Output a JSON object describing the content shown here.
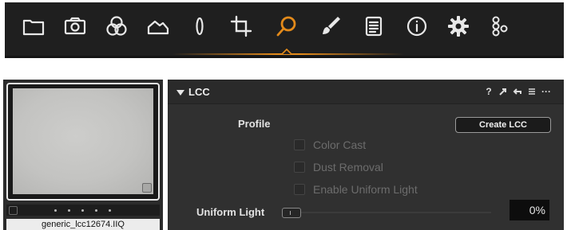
{
  "toolbar": {
    "active_tool": "Magnifier tool",
    "accent_color": "#e38a1a",
    "icon_color": "#e8e8e8",
    "tools": [
      {
        "name": "folder-icon",
        "label": "Library"
      },
      {
        "name": "camera-icon",
        "label": "Capture"
      },
      {
        "name": "color-circles-icon",
        "label": "Color"
      },
      {
        "name": "exposure-icon",
        "label": "Exposure"
      },
      {
        "name": "lens-icon",
        "label": "Lens"
      },
      {
        "name": "crop-icon",
        "label": "Composition"
      },
      {
        "name": "magnifier-icon",
        "label": "Details"
      },
      {
        "name": "brush-icon",
        "label": "Local Adjustments"
      },
      {
        "name": "document-icon",
        "label": "Output"
      },
      {
        "name": "info-icon",
        "label": "Metadata"
      },
      {
        "name": "gear-icon",
        "label": "Adjustments"
      },
      {
        "name": "batch-icon",
        "label": "Batch"
      }
    ]
  },
  "browser": {
    "filename": "generic_lcc12674.IIQ",
    "stars": 5
  },
  "lcc_panel": {
    "title": "LCC",
    "header_icons": [
      "help-icon",
      "reset-icon",
      "copy-icon",
      "list-icon",
      "more-icon"
    ],
    "help_glyph": "?",
    "more_glyph": "···",
    "profile_label": "Profile",
    "profile_value": "",
    "create_button_label": "Create LCC",
    "checkboxes": [
      {
        "label": "Color Cast",
        "checked": false
      },
      {
        "label": "Dust Removal",
        "checked": false
      },
      {
        "label": "Enable Uniform Light",
        "checked": false
      }
    ],
    "uniform_light_label": "Uniform Light",
    "uniform_light_value": "0%",
    "uniform_light_fraction": 0.0
  }
}
